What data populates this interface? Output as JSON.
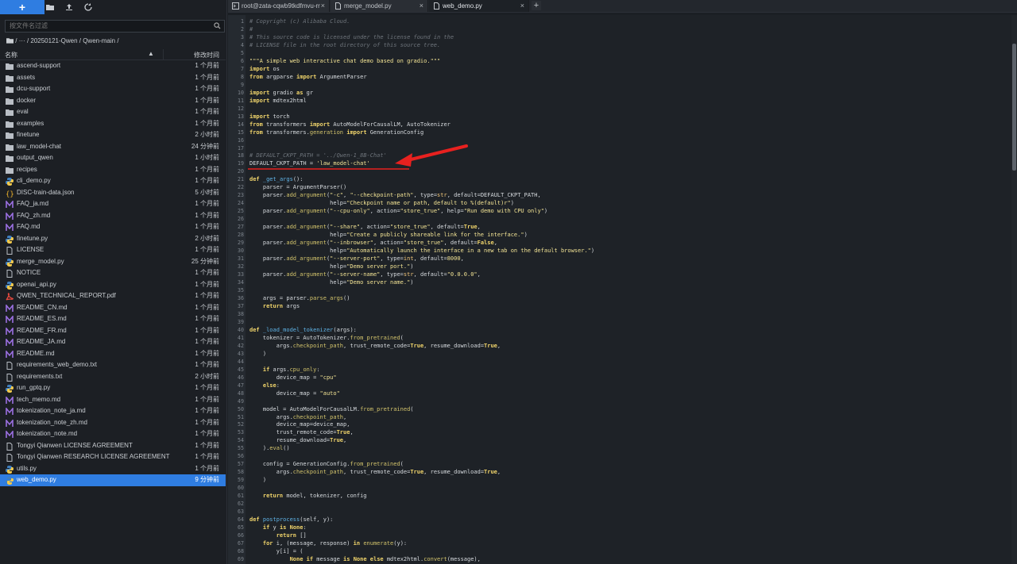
{
  "toolbar": {
    "new_label": "+"
  },
  "filter": {
    "placeholder": "按文件名过滤"
  },
  "breadcrumb": {
    "root": "/",
    "ellipsis": "···",
    "path": "/ 20250121-Qwen / Qwen-main /"
  },
  "columns": {
    "name": "名称",
    "sort_arrow": "▲",
    "modified": "修改时间"
  },
  "files": [
    {
      "name": "ascend-support",
      "time": "1 个月前",
      "type": "folder"
    },
    {
      "name": "assets",
      "time": "1 个月前",
      "type": "folder"
    },
    {
      "name": "dcu-support",
      "time": "1 个月前",
      "type": "folder"
    },
    {
      "name": "docker",
      "time": "1 个月前",
      "type": "folder"
    },
    {
      "name": "eval",
      "time": "1 个月前",
      "type": "folder"
    },
    {
      "name": "examples",
      "time": "1 个月前",
      "type": "folder"
    },
    {
      "name": "finetune",
      "time": "2 小时前",
      "type": "folder"
    },
    {
      "name": "law_model-chat",
      "time": "24 分钟前",
      "type": "folder"
    },
    {
      "name": "output_qwen",
      "time": "1 小时前",
      "type": "folder"
    },
    {
      "name": "recipes",
      "time": "1 个月前",
      "type": "folder"
    },
    {
      "name": "cli_demo.py",
      "time": "1 个月前",
      "type": "python"
    },
    {
      "name": "DISC-train-data.json",
      "time": "5 小时前",
      "type": "json"
    },
    {
      "name": "FAQ_ja.md",
      "time": "1 个月前",
      "type": "md"
    },
    {
      "name": "FAQ_zh.md",
      "time": "1 个月前",
      "type": "md"
    },
    {
      "name": "FAQ.md",
      "time": "1 个月前",
      "type": "md"
    },
    {
      "name": "finetune.py",
      "time": "2 小时前",
      "type": "python"
    },
    {
      "name": "LICENSE",
      "time": "1 个月前",
      "type": "file"
    },
    {
      "name": "merge_model.py",
      "time": "25 分钟前",
      "type": "python"
    },
    {
      "name": "NOTICE",
      "time": "1 个月前",
      "type": "file"
    },
    {
      "name": "openai_api.py",
      "time": "1 个月前",
      "type": "python"
    },
    {
      "name": "QWEN_TECHNICAL_REPORT.pdf",
      "time": "1 个月前",
      "type": "pdf"
    },
    {
      "name": "README_CN.md",
      "time": "1 个月前",
      "type": "md"
    },
    {
      "name": "README_ES.md",
      "time": "1 个月前",
      "type": "md"
    },
    {
      "name": "README_FR.md",
      "time": "1 个月前",
      "type": "md"
    },
    {
      "name": "README_JA.md",
      "time": "1 个月前",
      "type": "md"
    },
    {
      "name": "README.md",
      "time": "1 个月前",
      "type": "md"
    },
    {
      "name": "requirements_web_demo.txt",
      "time": "1 个月前",
      "type": "file"
    },
    {
      "name": "requirements.txt",
      "time": "2 小时前",
      "type": "file"
    },
    {
      "name": "run_gptq.py",
      "time": "1 个月前",
      "type": "python"
    },
    {
      "name": "tech_memo.md",
      "time": "1 个月前",
      "type": "md"
    },
    {
      "name": "tokenization_note_ja.md",
      "time": "1 个月前",
      "type": "md"
    },
    {
      "name": "tokenization_note_zh.md",
      "time": "1 个月前",
      "type": "md"
    },
    {
      "name": "tokenization_note.md",
      "time": "1 个月前",
      "type": "md"
    },
    {
      "name": "Tongyi Qianwen LICENSE AGREEMENT",
      "time": "1 个月前",
      "type": "file"
    },
    {
      "name": "Tongyi Qianwen RESEARCH LICENSE AGREEMENT",
      "time": "1 个月前",
      "type": "file"
    },
    {
      "name": "utils.py",
      "time": "1 个月前",
      "type": "python"
    },
    {
      "name": "web_demo.py",
      "time": "9 分钟前",
      "type": "python",
      "selected": true
    }
  ],
  "tabs": [
    {
      "label": "root@zata-cqwb9tkdfmvu-rr",
      "close": "×",
      "active": false
    },
    {
      "label": "merge_model.py",
      "close": "×",
      "active": false
    },
    {
      "label": "web_demo.py",
      "close": "×",
      "active": true
    }
  ],
  "tab_add": "+",
  "code": [
    "<span class='c'># Copyright (c) Alibaba Cloud.</span>",
    "<span class='c'>#</span>",
    "<span class='c'># This source code is licensed under the license found in the</span>",
    "<span class='c'># LICENSE file in the root directory of this source tree.</span>",
    "",
    "<span class='s'>\"\"\"A simple web interactive chat demo based on gradio.\"\"\"</span>",
    "<span class='k'>import</span> os",
    "<span class='k'>from</span> argparse <span class='k'>import</span> ArgumentParser",
    "",
    "<span class='k'>import</span> gradio <span class='k'>as</span> gr",
    "<span class='k'>import</span> mdtex2html",
    "",
    "<span class='k'>import</span> torch",
    "<span class='k'>from</span> transformers <span class='k'>import</span> AutoModelForCausalLM, AutoTokenizer",
    "<span class='k'>from</span> transformers.<span class='m'>generation</span> <span class='k'>import</span> GenerationConfig",
    "",
    "",
    "<span class='c'># DEFAULT_CKPT_PATH = '../Qwen-1_8B-Chat'</span>",
    "DEFAULT_CKPT_PATH = <span class='s'>'law_model-chat'</span>",
    "",
    "<span class='k'>def</span> <span class='f'>_get_args</span>():",
    "    parser = ArgumentParser()",
    "    parser.<span class='m'>add_argument</span>(<span class='s'>\"-c\"</span>, <span class='s'>\"--checkpoint-path\"</span>, type=<span class='b'>str</span>, default=DEFAULT_CKPT_PATH,",
    "                        help=<span class='s'>\"Checkpoint name or path, default to %(default)r\"</span>)",
    "    parser.<span class='m'>add_argument</span>(<span class='s'>\"--cpu-only\"</span>, action=<span class='s'>\"store_true\"</span>, help=<span class='s'>\"Run demo with CPU only\"</span>)",
    "",
    "    parser.<span class='m'>add_argument</span>(<span class='s'>\"--share\"</span>, action=<span class='s'>\"store_true\"</span>, default=<span class='k'>True</span>,",
    "                        help=<span class='s'>\"Create a publicly shareable link for the interface.\"</span>)",
    "    parser.<span class='m'>add_argument</span>(<span class='s'>\"--inbrowser\"</span>, action=<span class='s'>\"store_true\"</span>, default=<span class='k'>False</span>,",
    "                        help=<span class='s'>\"Automatically launch the interface in a new tab on the default browser.\"</span>)",
    "    parser.<span class='m'>add_argument</span>(<span class='s'>\"--server-port\"</span>, type=<span class='b'>int</span>, default=<span class='s'>8000</span>,",
    "                        help=<span class='s'>\"Demo server port.\"</span>)",
    "    parser.<span class='m'>add_argument</span>(<span class='s'>\"--server-name\"</span>, type=<span class='b'>str</span>, default=<span class='s'>\"0.0.0.0\"</span>,",
    "                        help=<span class='s'>\"Demo server name.\"</span>)",
    "",
    "    args = parser.<span class='m'>parse_args</span>()",
    "    <span class='k'>return</span> args",
    "",
    "",
    "<span class='k'>def</span> <span class='f'>_load_model_tokenizer</span>(args):",
    "    tokenizer = AutoTokenizer.<span class='m'>from_pretrained</span>(",
    "        args.<span class='m'>checkpoint_path</span>, trust_remote_code=<span class='k'>True</span>, resume_download=<span class='k'>True</span>,",
    "    )",
    "",
    "    <span class='k'>if</span> args.<span class='m'>cpu_only</span>:",
    "        device_map = <span class='s'>\"cpu\"</span>",
    "    <span class='k'>else</span>:",
    "        device_map = <span class='s'>\"auto\"</span>",
    "",
    "    model = AutoModelForCausalLM.<span class='m'>from_pretrained</span>(",
    "        args.<span class='m'>checkpoint_path</span>,",
    "        device_map=device_map,",
    "        trust_remote_code=<span class='k'>True</span>,",
    "        resume_download=<span class='k'>True</span>,",
    "    ).<span class='m'>eval</span>()",
    "",
    "    config = GenerationConfig.<span class='m'>from_pretrained</span>(",
    "        args.<span class='m'>checkpoint_path</span>, trust_remote_code=<span class='k'>True</span>, resume_download=<span class='k'>True</span>,",
    "    )",
    "",
    "    <span class='k'>return</span> model, tokenizer, config",
    "",
    "",
    "<span class='k'>def</span> <span class='f'>postprocess</span>(self, y):",
    "    <span class='k'>if</span> y <span class='k'>is</span> <span class='k'>None</span>:",
    "        <span class='k'>return</span> []",
    "    <span class='k'>for</span> i, (message, response) <span class='k'>in</span> <span class='m'>enumerate</span>(y):",
    "        y[i] = (",
    "            <span class='k'>None</span> <span class='k'>if</span> message <span class='k'>is</span> <span class='k'>None</span> <span class='k'>else</span> mdtex2html.<span class='m'>convert</span>(message),"
  ],
  "colors": {
    "accent": "#2f7de1",
    "annotation": "#e8211f",
    "background": "#1e2227"
  }
}
